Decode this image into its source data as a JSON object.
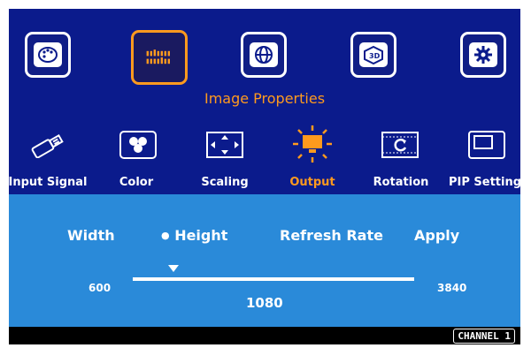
{
  "main_menu": {
    "title": "Image Properties",
    "icons": [
      "palette-icon",
      "image-properties-icon",
      "globe-icon",
      "3d-icon",
      "gear-icon"
    ],
    "selected_index": 1
  },
  "sub_menu": {
    "items": [
      {
        "label": "Input Signal",
        "icon": "usb-plug-icon"
      },
      {
        "label": "Color",
        "icon": "color-circles-icon"
      },
      {
        "label": "Scaling",
        "icon": "scaling-arrows-icon"
      },
      {
        "label": "Output",
        "icon": "output-monitor-icon"
      },
      {
        "label": "Rotation",
        "icon": "rotation-icon"
      },
      {
        "label": "PIP Setting",
        "icon": "pip-icon"
      }
    ],
    "selected_index": 3
  },
  "output_settings": {
    "options": [
      "Width",
      "Height",
      "Refresh Rate",
      "Apply"
    ],
    "selected_option": "Height",
    "bullet": "●",
    "slider": {
      "min": "600",
      "max": "3840",
      "value": "1080"
    }
  },
  "status": {
    "channel": "CHANNEL 1"
  },
  "colors": {
    "top_panel": "#0b1b8c",
    "bottom_panel": "#2a8ad9",
    "accent": "#ff9a1e"
  }
}
